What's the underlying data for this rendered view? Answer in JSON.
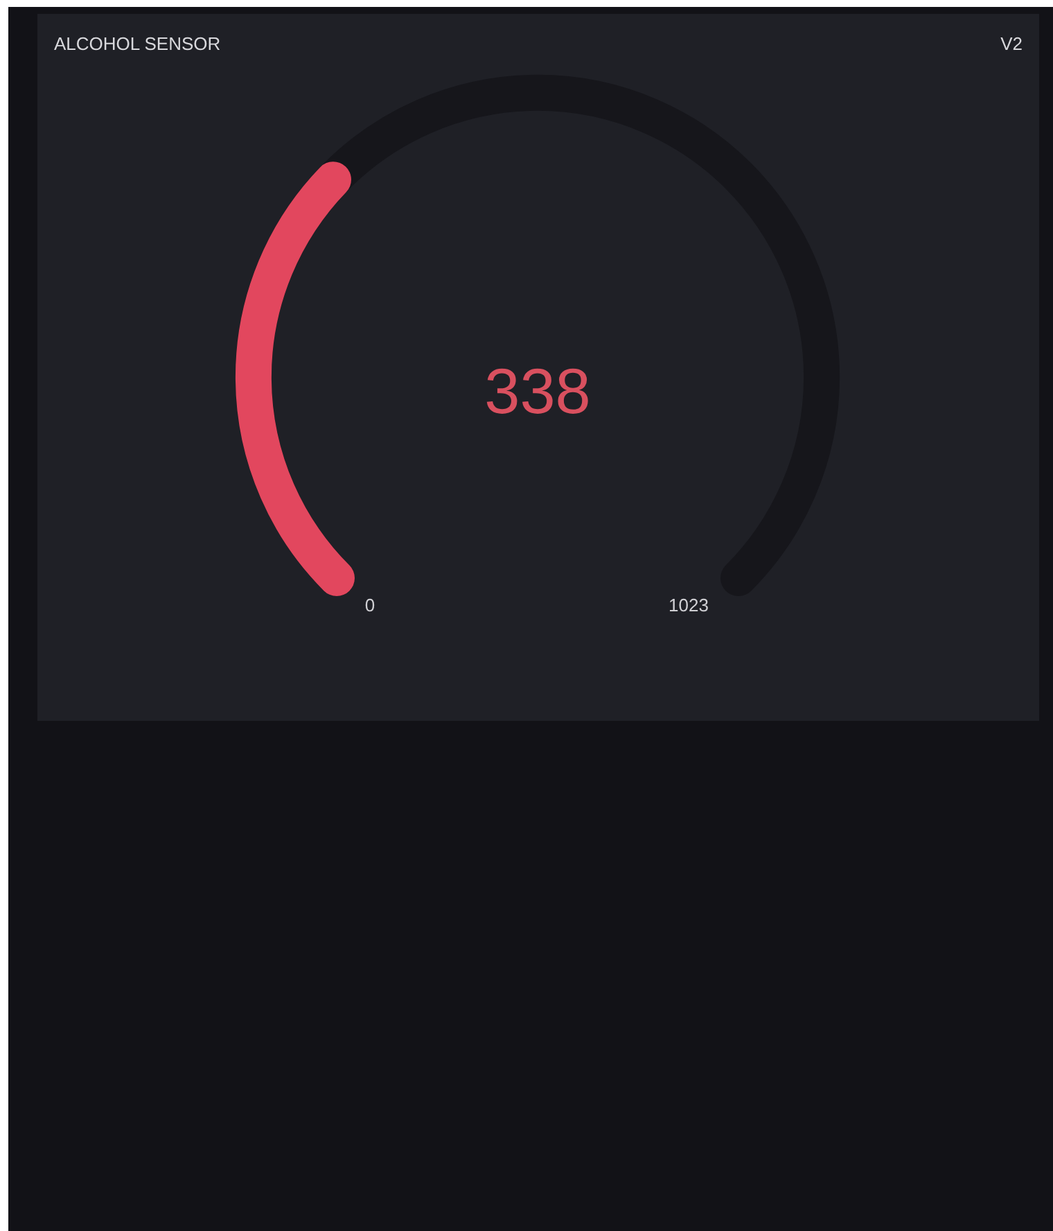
{
  "widget": {
    "title": "ALCOHOL SENSOR",
    "pin": "V2",
    "gauge": {
      "value": "338",
      "min_label": "0",
      "max_label": "1023"
    }
  }
}
